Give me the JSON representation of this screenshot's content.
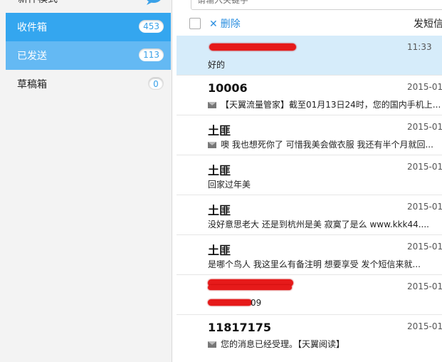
{
  "sidebar": {
    "top_label": "新件模式",
    "items": [
      {
        "label": "收件箱",
        "count": "453"
      },
      {
        "label": "已发送",
        "count": "113"
      },
      {
        "label": "草稿箱",
        "count": "0"
      }
    ]
  },
  "search": {
    "placeholder": "请输入关键字"
  },
  "toolbar": {
    "delete_label": "删除",
    "send_label": "发短信"
  },
  "messages": [
    {
      "sender": "",
      "date": "11:33",
      "preview": "好的",
      "selected": true
    },
    {
      "sender": "10006",
      "date": "2015-01-",
      "preview": "【天翼流量管家】截至01月13日24时，您的国内手机上..."
    },
    {
      "sender": "土匪",
      "date": "2015-01-",
      "preview": "噢 我也想死你了 可惜我美会做衣服 我还有半个月就回..."
    },
    {
      "sender": "土匪",
      "date": "2015-01-",
      "preview": "回家过年美"
    },
    {
      "sender": "土匪",
      "date": "2015-01-",
      "preview": "没好意思老大 还是到杭州是美 寂寞了是么 www.kkk44...."
    },
    {
      "sender": "土匪",
      "date": "2015-01-",
      "preview": "是哪个鸟人 我这里么有备注明 想要享受 发个短信来就..."
    },
    {
      "sender": "",
      "date": "2015-01-",
      "preview": "09"
    },
    {
      "sender": "11817175",
      "date": "2015-01-",
      "preview": "您的消息已经受理。【天翼阅读】"
    }
  ]
}
